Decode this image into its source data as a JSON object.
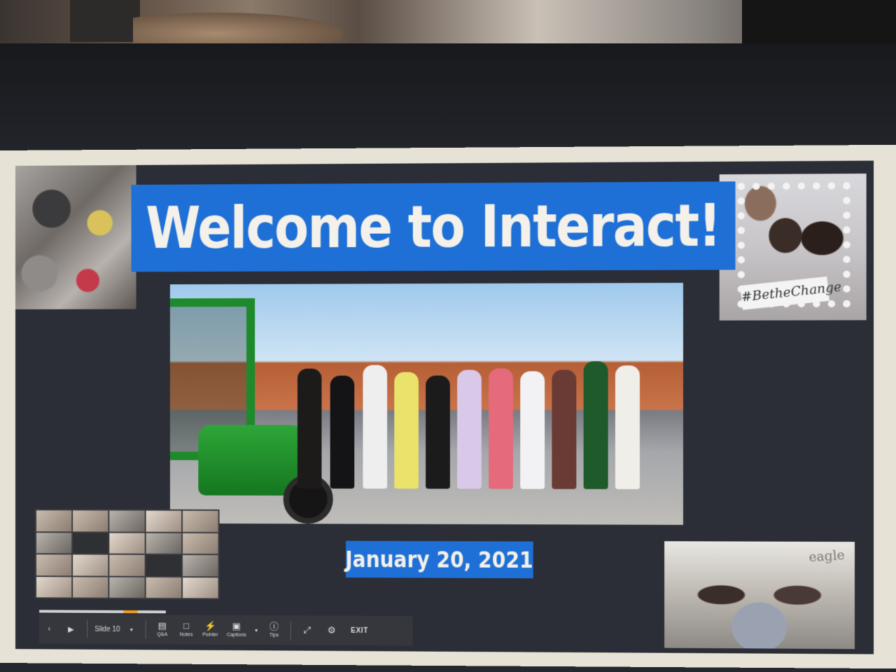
{
  "slide": {
    "title": "Welcome to Interact!",
    "date": "January 20, 2021",
    "frame_text": "#BetheChange",
    "corner_text": "eagle"
  },
  "toolbar": {
    "slide_label": "Slide 10",
    "qa_label": "Q&A",
    "notes_label": "Notes",
    "pointer_label": "Pointer",
    "captions_label": "Captions",
    "tips_label": "Tips",
    "exit_label": "EXIT"
  },
  "colors": {
    "banner_blue": "#1e6fd6",
    "slide_bg": "#2b2e36",
    "toolbar_bg": "#35373d"
  },
  "icons": [
    "previous-icon",
    "play-icon",
    "chevron-down-icon",
    "chat-icon",
    "notes-icon",
    "pointer-icon",
    "captions-icon",
    "info-icon",
    "fullscreen-exit-icon",
    "gear-icon"
  ]
}
